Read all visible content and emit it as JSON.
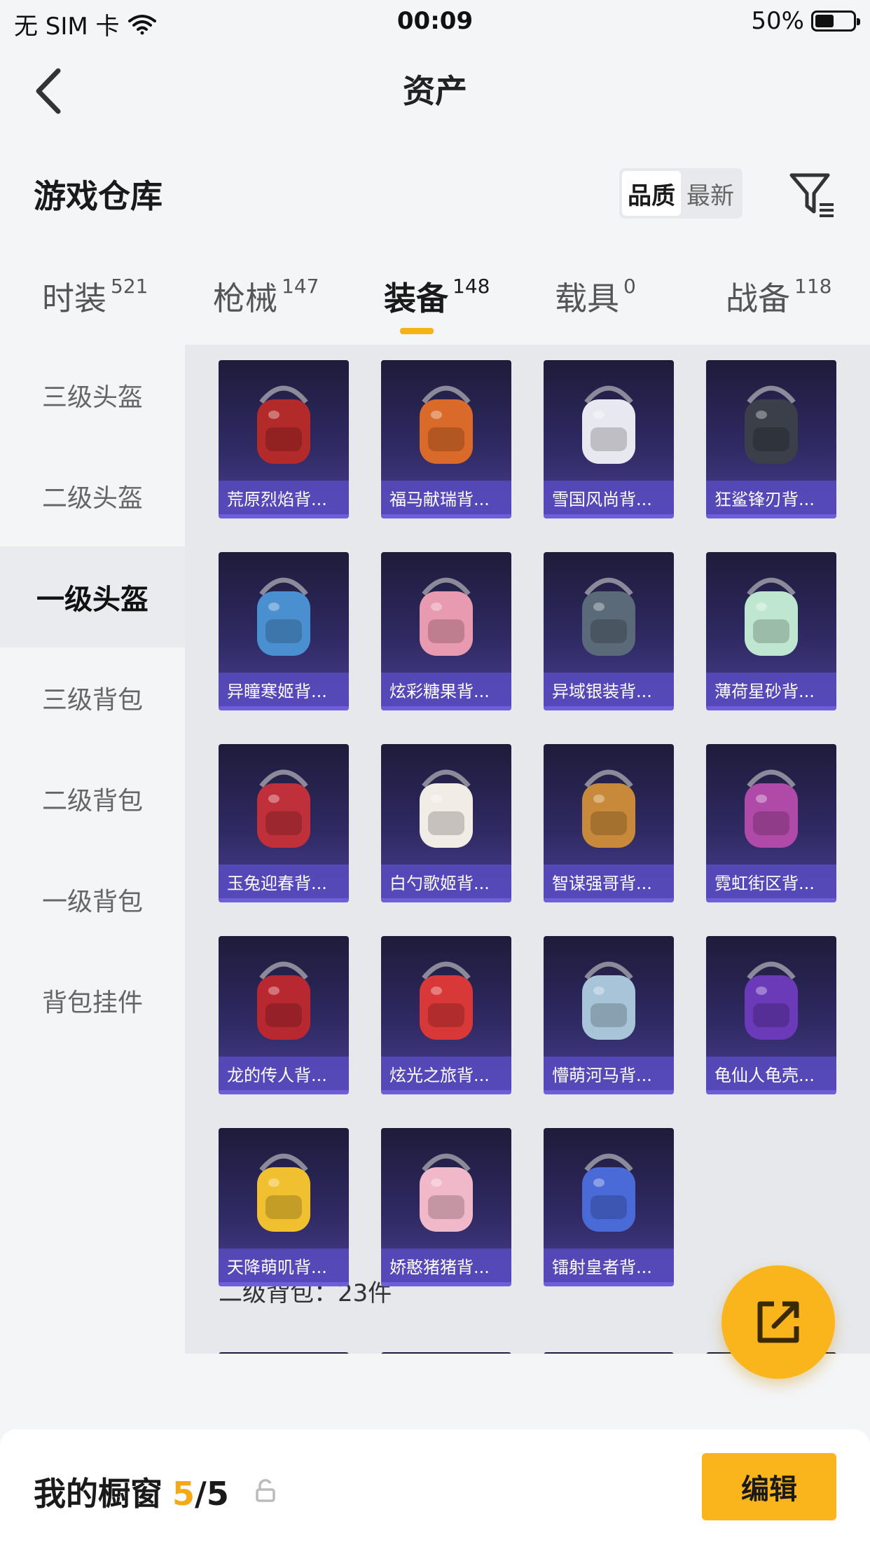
{
  "status_bar": {
    "carrier": "无 SIM 卡",
    "time": "00:09",
    "battery": "50%",
    "battery_level": 0.5
  },
  "nav": {
    "title": "资产"
  },
  "section": {
    "title": "游戏仓库",
    "sort_options": [
      "品质",
      "最新"
    ],
    "active_sort": "品质"
  },
  "tabs": [
    {
      "label": "时装",
      "count": "521"
    },
    {
      "label": "枪械",
      "count": "147"
    },
    {
      "label": "装备",
      "count": "148"
    },
    {
      "label": "载具",
      "count": "0"
    },
    {
      "label": "战备",
      "count": "118"
    }
  ],
  "active_tab": "装备",
  "sidebar": {
    "items": [
      {
        "label": "三级头盔"
      },
      {
        "label": "二级头盔"
      },
      {
        "label": "一级头盔"
      },
      {
        "label": "三级背包"
      },
      {
        "label": "二级背包"
      },
      {
        "label": "一级背包"
      },
      {
        "label": "背包挂件"
      }
    ],
    "active": "一级头盔"
  },
  "items": [
    {
      "name": "荒原烈焰背...",
      "color": "#b32a2a"
    },
    {
      "name": "福马献瑞背...",
      "color": "#d96a2a"
    },
    {
      "name": "雪国风尚背...",
      "color": "#e8e8f0"
    },
    {
      "name": "狂鲨锋刃背...",
      "color": "#3a3f4a"
    },
    {
      "name": "异瞳寒姬背...",
      "color": "#4a90d0"
    },
    {
      "name": "炫彩糖果背...",
      "color": "#e89ab0"
    },
    {
      "name": "异域银装背...",
      "color": "#5a6a78"
    },
    {
      "name": "薄荷星砂背...",
      "color": "#bfe6d0"
    },
    {
      "name": "玉兔迎春背...",
      "color": "#c0303a"
    },
    {
      "name": "白勺歌姬背...",
      "color": "#f2ece6"
    },
    {
      "name": "智谋强哥背...",
      "color": "#c88a3a"
    },
    {
      "name": "霓虹街区背...",
      "color": "#b04aa8"
    },
    {
      "name": "龙的传人背...",
      "color": "#b82830"
    },
    {
      "name": "炫光之旅背...",
      "color": "#d83838"
    },
    {
      "name": "懵萌河马背...",
      "color": "#a8c4d8"
    },
    {
      "name": "龟仙人龟壳...",
      "color": "#6a3ab8"
    },
    {
      "name": "天降萌叽背...",
      "color": "#f0c030"
    },
    {
      "name": "娇憨猪猪背...",
      "color": "#f0b8c8"
    },
    {
      "name": "镭射皇者背...",
      "color": "#4a6ad8"
    }
  ],
  "group_footer": "二级背包：23件",
  "bottom_bar": {
    "title": "我的橱窗",
    "count_current": "5",
    "count_total": "/5",
    "edit_label": "编辑"
  },
  "colors": {
    "accent": "#f9b51b",
    "card_label": "#584abe"
  }
}
